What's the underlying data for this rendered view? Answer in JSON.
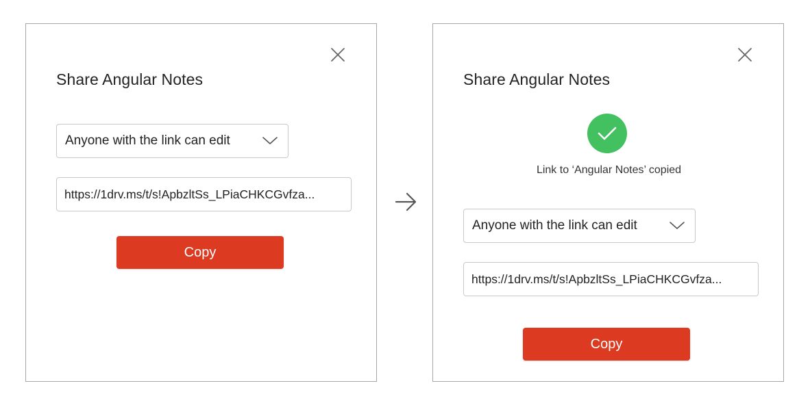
{
  "dialogs": [
    {
      "state": "before",
      "title": "Share Angular Notes",
      "permission": "Anyone with the link can edit",
      "link": "https://1drv.ms/t/s!ApbzltSs_LPiaCHKCGvfza...",
      "copy_label": "Copy"
    },
    {
      "state": "after",
      "title": "Share Angular Notes",
      "confirmation": "Link to ‘Angular Notes’ copied",
      "permission": "Anyone with the link can edit",
      "link": "https://1drv.ms/t/s!ApbzltSs_LPiaCHKCGvfza...",
      "copy_label": "Copy"
    }
  ],
  "icons": {
    "close": "close-icon",
    "dropdown": "chevron-down-icon",
    "success": "checkmark-circle-icon",
    "flow": "arrow-right-icon"
  },
  "colors": {
    "accent": "#dd3a22",
    "success": "#43c160",
    "border": "#a6a6a6",
    "field_border": "#c9c9c9"
  }
}
